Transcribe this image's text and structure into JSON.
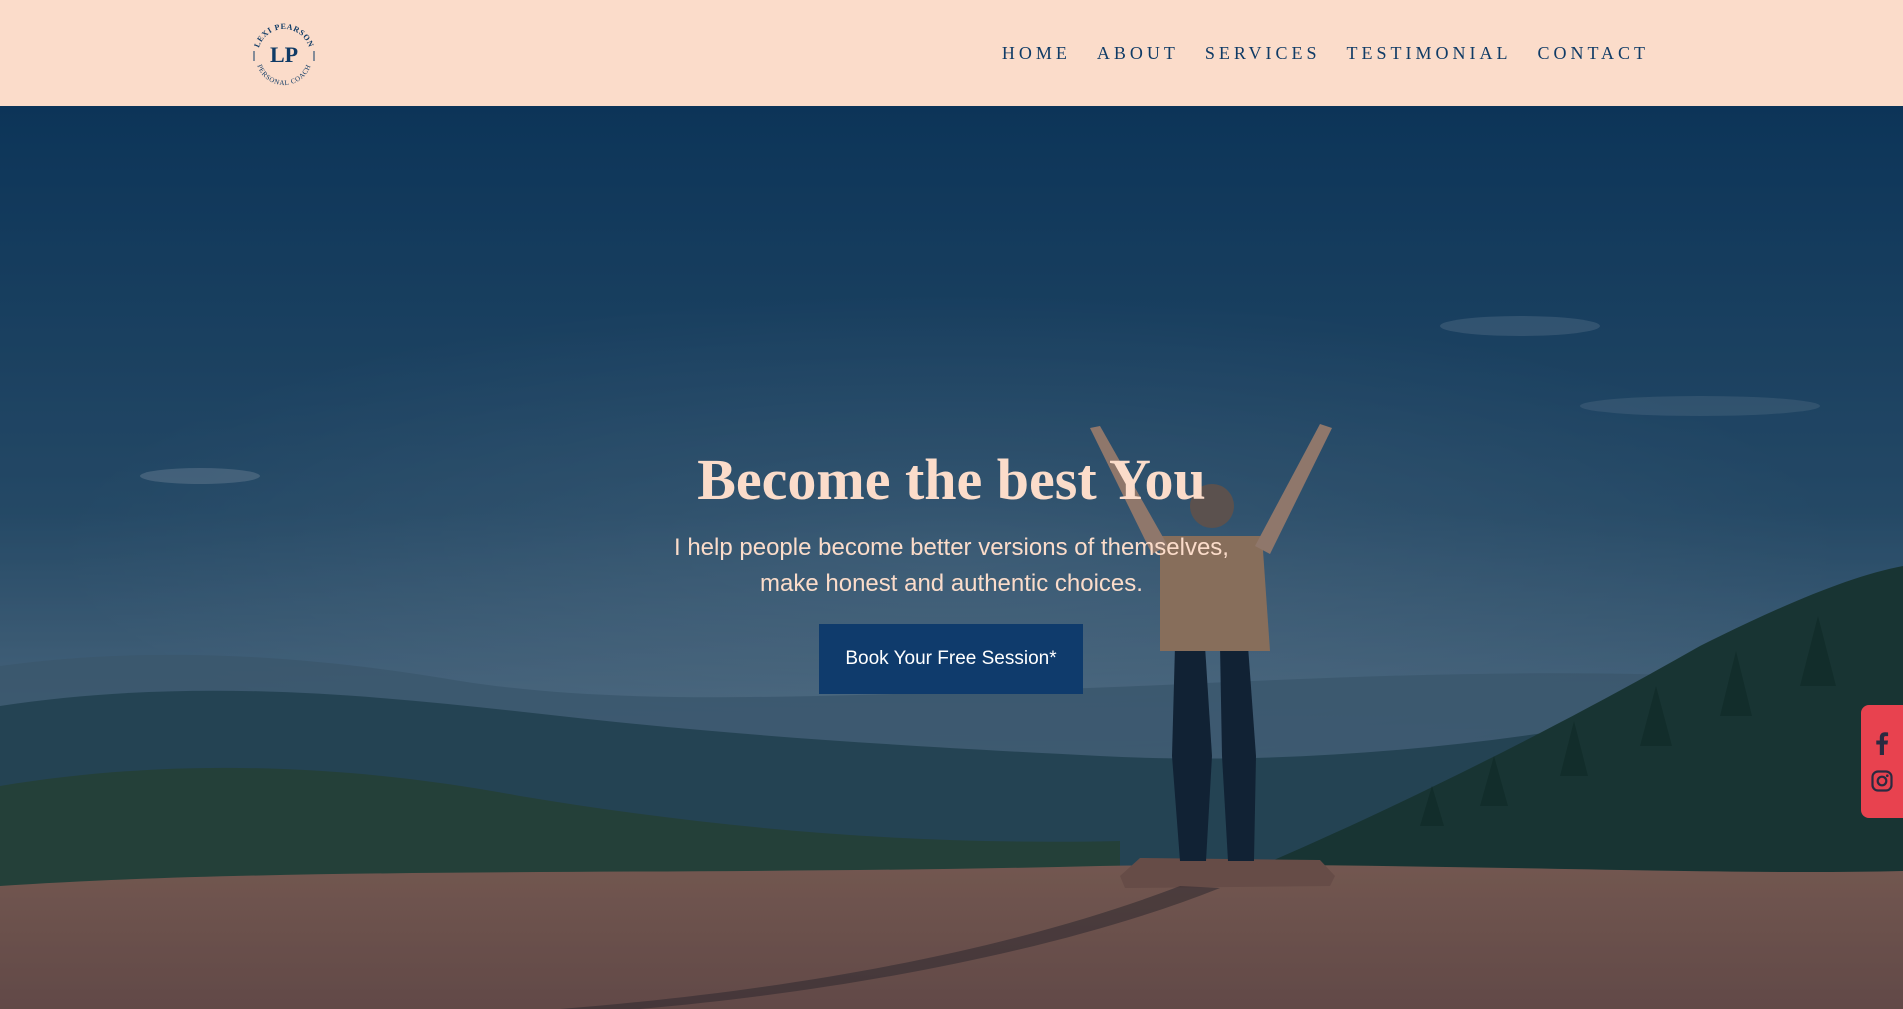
{
  "brand": {
    "logo_initials": "LP",
    "logo_ring_top": "LEXI PEARSON",
    "logo_ring_bottom": "PERSONAL COACH"
  },
  "nav": {
    "items": [
      "HOME",
      "ABOUT",
      "SERVICES",
      "TESTIMONIAL",
      "CONTACT"
    ]
  },
  "hero": {
    "title": "Become the best You",
    "subtitle_line1": "I help people become better versions of themselves,",
    "subtitle_line2": "make honest and authentic choices.",
    "cta_label": "Book Your Free Session*"
  },
  "social": {
    "icons": [
      "facebook-icon",
      "instagram-icon"
    ]
  },
  "colors": {
    "header_bg": "#fbdcca",
    "nav_text": "#0f3b66",
    "cta_bg": "#0f3b6c",
    "title_text": "#fbdcca",
    "social_bg": "#e8424f"
  }
}
